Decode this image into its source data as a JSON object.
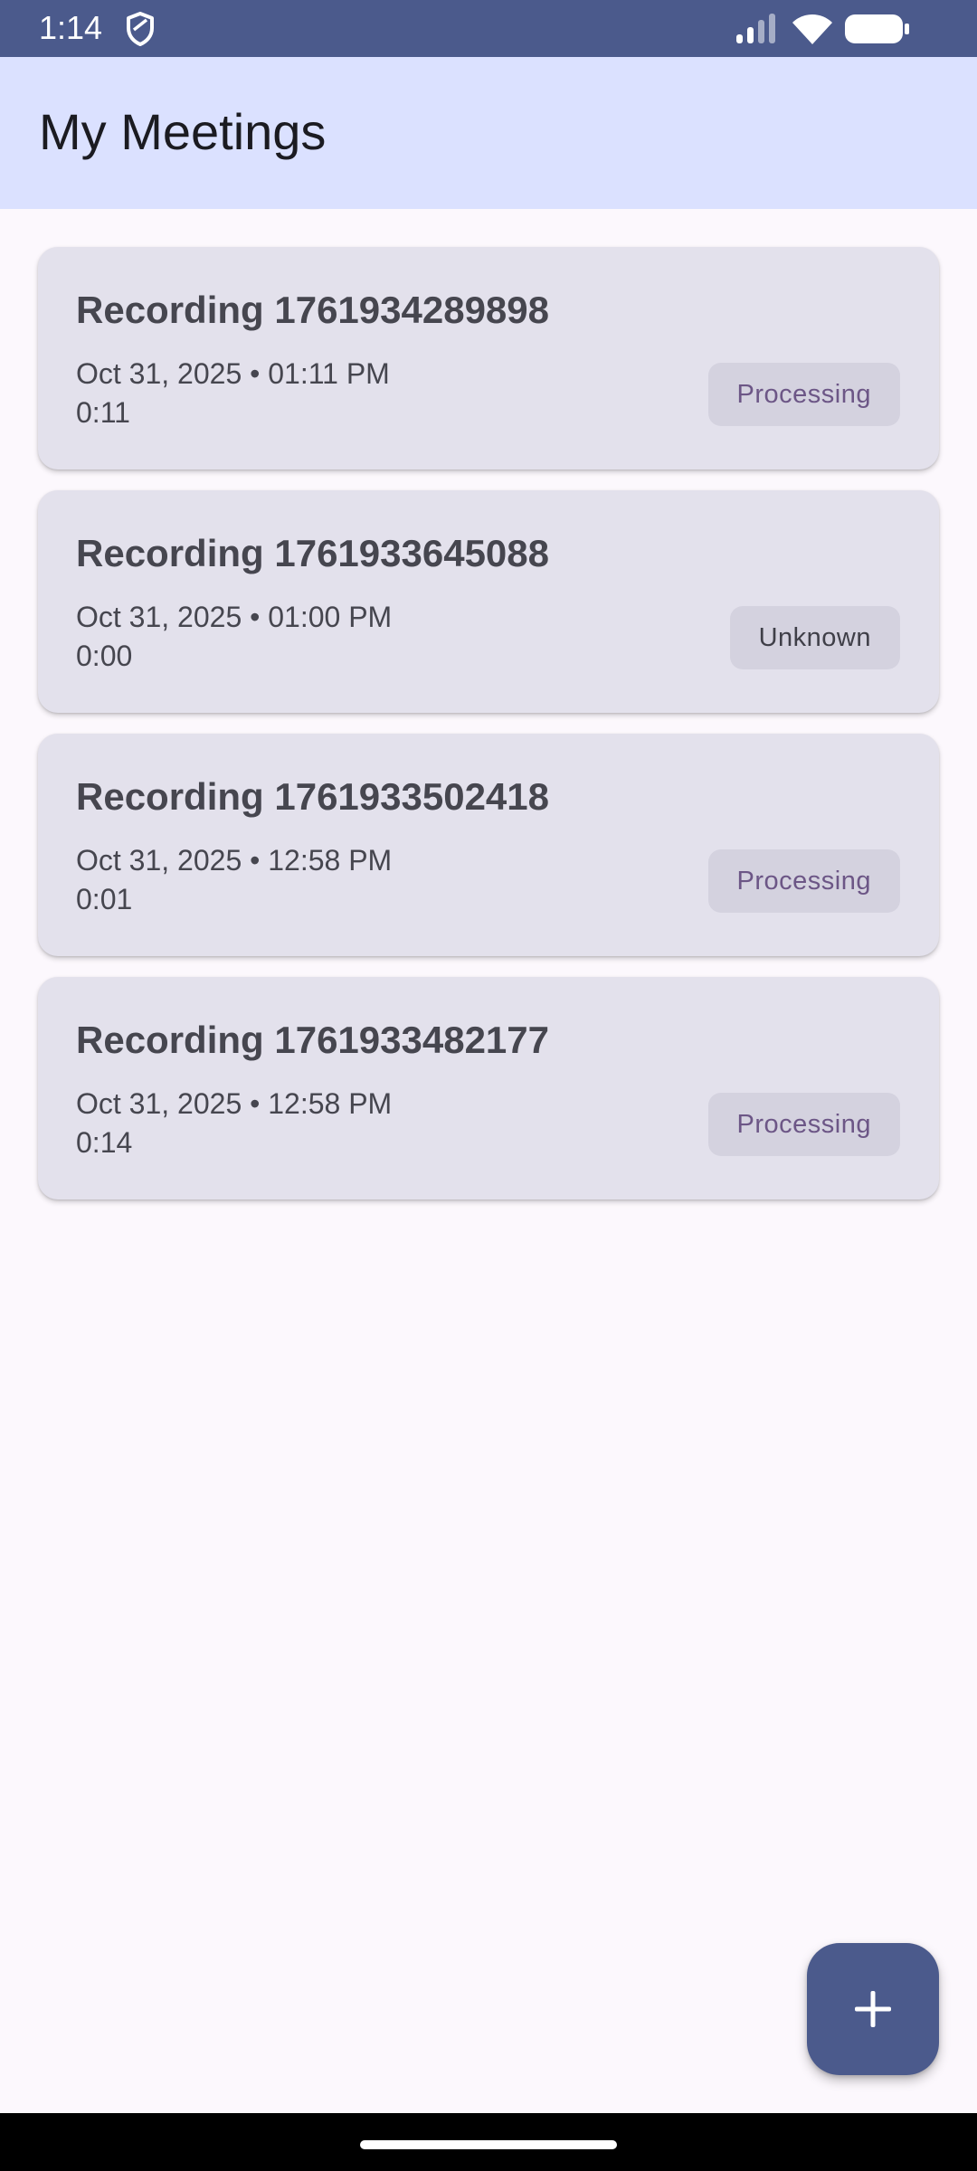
{
  "status_bar": {
    "time": "1:14",
    "icons": [
      "shield-icon",
      "signal-icon",
      "wifi-icon",
      "battery-icon"
    ]
  },
  "app_bar": {
    "title": "My Meetings"
  },
  "recordings": [
    {
      "title": "Recording 1761934289898",
      "date": "Oct 31, 2025 • 01:11 PM",
      "duration": "0:11",
      "status": "Processing"
    },
    {
      "title": "Recording 1761933645088",
      "date": "Oct 31, 2025 • 01:00 PM",
      "duration": "0:00",
      "status": "Unknown"
    },
    {
      "title": "Recording 1761933502418",
      "date": "Oct 31, 2025 • 12:58 PM",
      "duration": "0:01",
      "status": "Processing"
    },
    {
      "title": "Recording 1761933482177",
      "date": "Oct 31, 2025 • 12:58 PM",
      "duration": "0:14",
      "status": "Processing"
    }
  ],
  "fab": {
    "icon": "plus-icon"
  },
  "colors": {
    "primary": "#4b5a8c",
    "app_bar_bg": "#dbe1ff",
    "card_bg": "#e3e1ec",
    "chip_bg": "#d4d2df",
    "processing_text": "#6c5686",
    "background": "#fcf8fd"
  }
}
